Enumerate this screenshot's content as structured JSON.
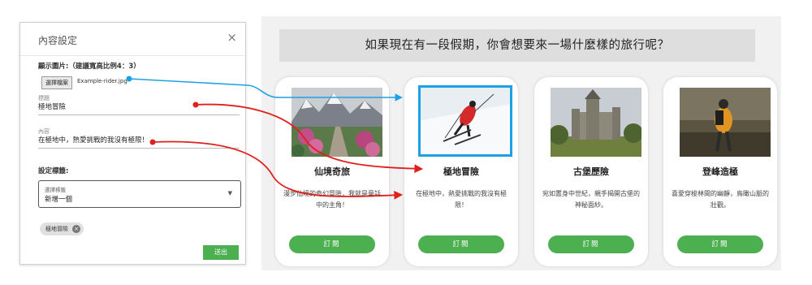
{
  "panel": {
    "title": "內容設定",
    "close_glyph": "×",
    "image_label": "顯示圖片:（建議寬高比例4：3）",
    "upload_button": "選擇檔案",
    "file_name": "Example-rider.jpg",
    "title_field": {
      "label": "標題",
      "value": "極地冒險"
    },
    "content_field": {
      "label": "內容",
      "value": "在極地中，熱愛挑戰的我沒有極限！"
    },
    "tags_heading": "設定標籤:",
    "tag_select": {
      "label": "選擇標籤",
      "value": "新增一個"
    },
    "chip_label": "極地冒險",
    "chip_remove_glyph": "×",
    "submit_label": "送出"
  },
  "preview": {
    "question": "如果現在有一段假期，你會想要來一場什麼樣的旅行呢？",
    "cards": [
      {
        "title": "仙境奇旅",
        "desc": "漫步仙境的奇幻冒險，我就是童話中的主角！",
        "button": "訂閱",
        "image": "mountain-garden-image"
      },
      {
        "title": "極地冒險",
        "desc": "在極地中，熱愛挑戰的我沒有極限！",
        "button": "訂閱",
        "image": "skier-image"
      },
      {
        "title": "古堡歷險",
        "desc": "宛如置身中世紀，親手揭開古堡的神秘面紗。",
        "button": "訂閱",
        "image": "castle-image"
      },
      {
        "title": "登峰造極",
        "desc": "喜愛穿梭林間的幽靜，鳥瞰山脈的壯觀。",
        "button": "訂閱",
        "image": "hiker-image"
      }
    ]
  },
  "colors": {
    "accent_green": "#4caf50",
    "link_blue": "#1da1e6",
    "link_red": "#e0201c",
    "question_bar": "#dedede",
    "preview_bg": "#f1f1f1"
  }
}
